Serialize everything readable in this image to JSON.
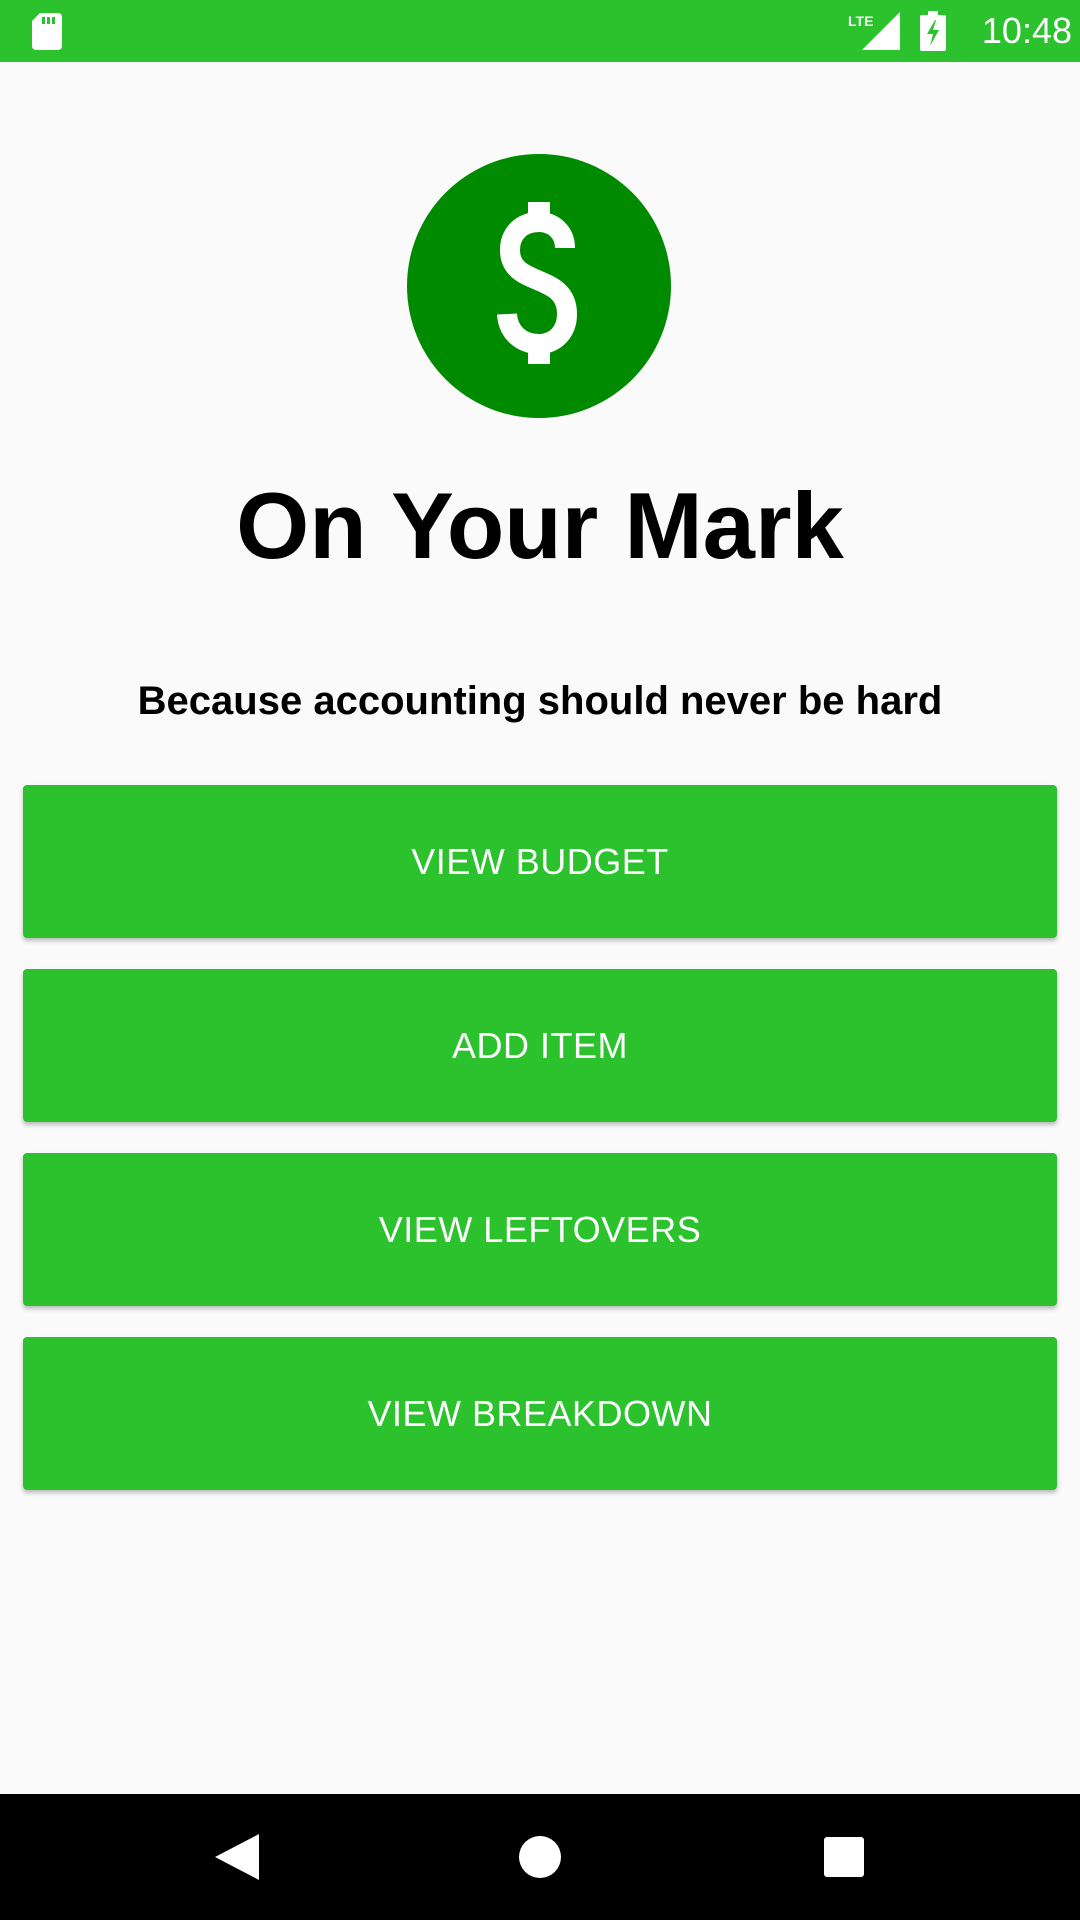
{
  "status_bar": {
    "time": "10:48",
    "network": "LTE",
    "color": "#2bc22e"
  },
  "logo": {
    "icon": "dollar-sign-icon",
    "color": "#008a00"
  },
  "app": {
    "title": "On Your Mark",
    "tagline": "Because accounting should never be hard"
  },
  "buttons": [
    {
      "label": "VIEW BUDGET"
    },
    {
      "label": "ADD ITEM"
    },
    {
      "label": "VIEW LEFTOVERS"
    },
    {
      "label": "VIEW BREAKDOWN"
    }
  ],
  "nav_bar": {
    "back_icon": "back-triangle-icon",
    "home_icon": "home-circle-icon",
    "recent_icon": "recent-apps-square-icon"
  }
}
